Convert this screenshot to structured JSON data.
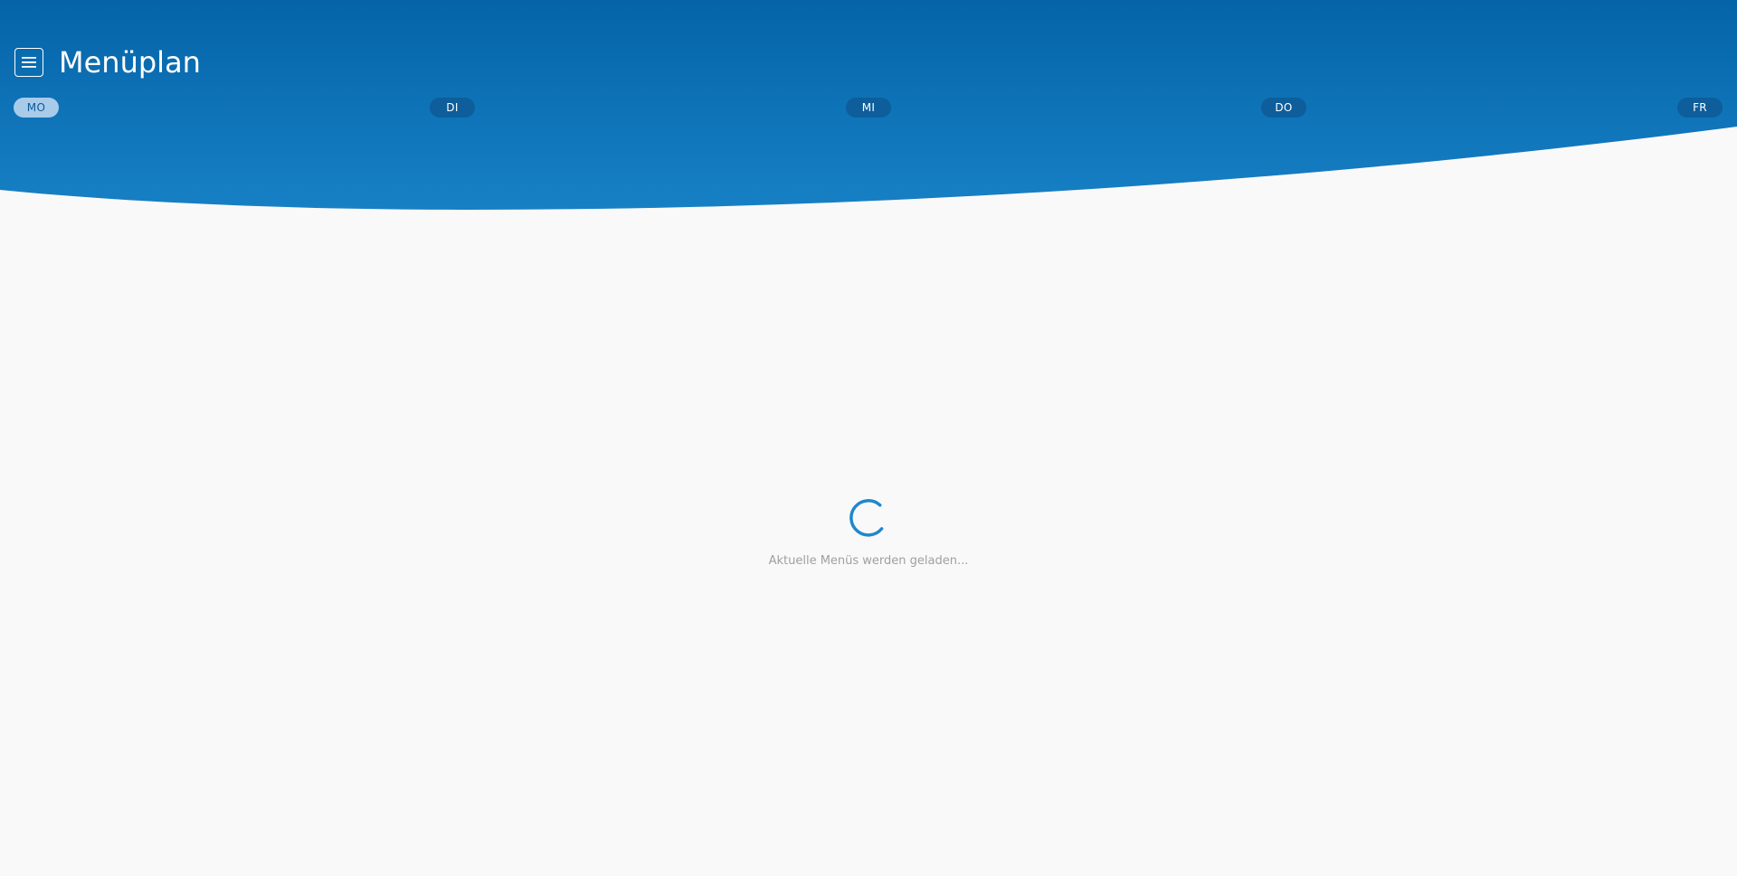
{
  "header": {
    "title": "Menüplan",
    "menu_icon": "hamburger-menu-icon",
    "colors": {
      "top": "#0564a8",
      "bottom": "#1780c5"
    }
  },
  "days": [
    {
      "label": "MO",
      "active": true
    },
    {
      "label": "DI",
      "active": false
    },
    {
      "label": "MI",
      "active": false
    },
    {
      "label": "DO",
      "active": false
    },
    {
      "label": "FR",
      "active": false
    }
  ],
  "loader": {
    "text": "Aktuelle Menüs werden geladen...",
    "icon": "spinner-icon",
    "color": "#2087cc"
  },
  "background_color": "#f9f9f9"
}
